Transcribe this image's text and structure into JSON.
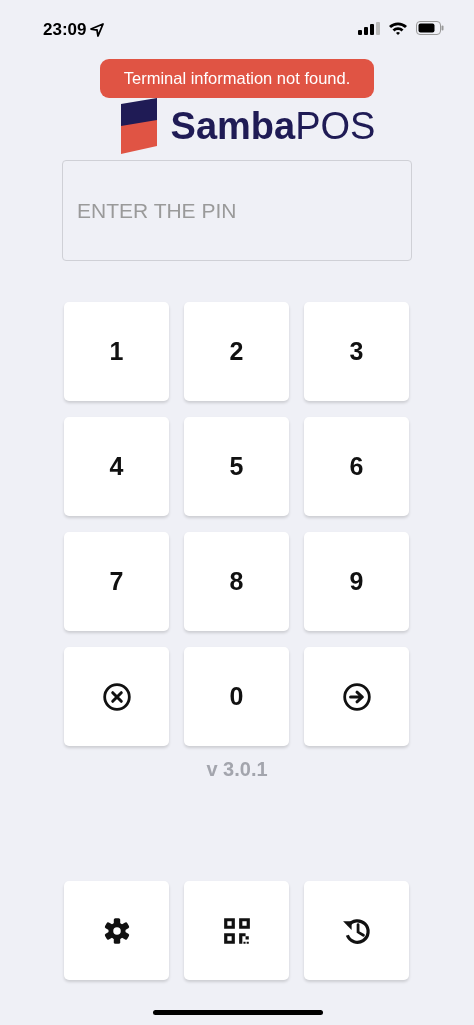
{
  "status_bar": {
    "time": "23:09"
  },
  "toast": {
    "message": "Terminal information not found."
  },
  "logo": {
    "text_bold": "Samba",
    "text_light": "POS"
  },
  "pin_field": {
    "placeholder": "ENTER THE PIN"
  },
  "keypad": [
    {
      "kind": "digit",
      "label": "1"
    },
    {
      "kind": "digit",
      "label": "2"
    },
    {
      "kind": "digit",
      "label": "3"
    },
    {
      "kind": "digit",
      "label": "4"
    },
    {
      "kind": "digit",
      "label": "5"
    },
    {
      "kind": "digit",
      "label": "6"
    },
    {
      "kind": "digit",
      "label": "7"
    },
    {
      "kind": "digit",
      "label": "8"
    },
    {
      "kind": "digit",
      "label": "9"
    },
    {
      "kind": "clear"
    },
    {
      "kind": "digit",
      "label": "0"
    },
    {
      "kind": "enter"
    }
  ],
  "version": "v 3.0.1",
  "bottom_buttons": [
    {
      "kind": "settings"
    },
    {
      "kind": "qr"
    },
    {
      "kind": "history"
    }
  ]
}
